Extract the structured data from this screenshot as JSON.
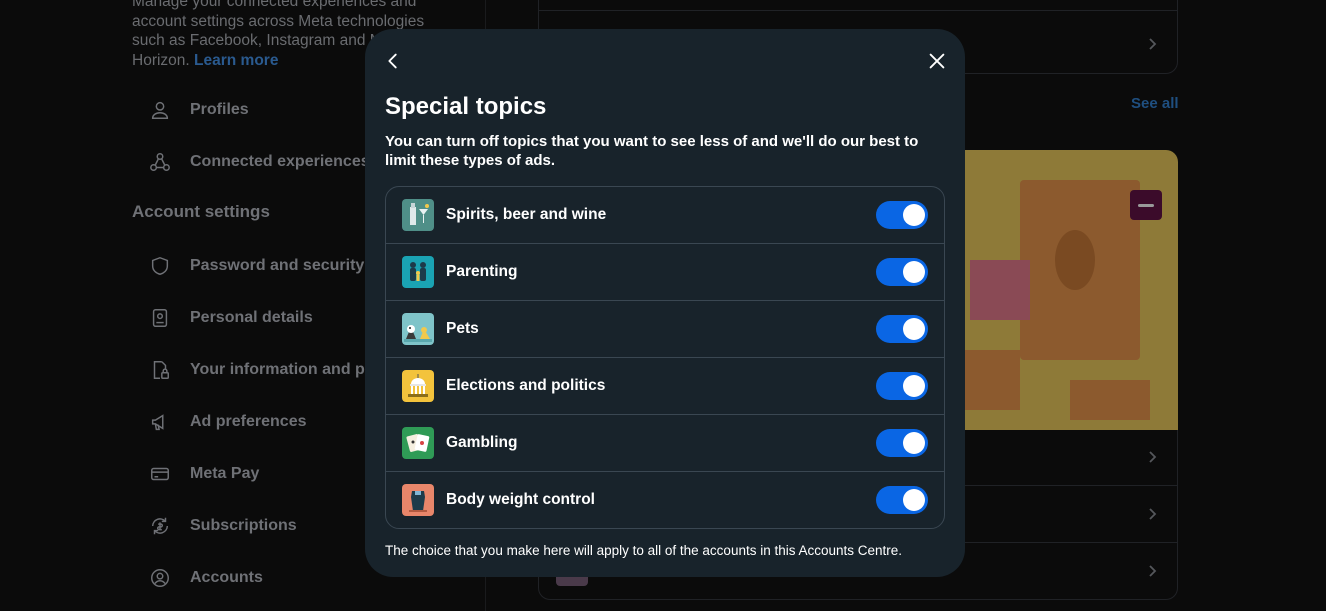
{
  "background": {
    "intro_lines": [
      "Manage your connected experiences and",
      "account settings across Meta technologies",
      "such as Facebook, Instagram and M",
      "Horizon."
    ],
    "learn_more": "Learn more",
    "nav_top": [
      {
        "label": "Profiles",
        "icon": "person-icon"
      },
      {
        "label": "Connected experiences",
        "icon": "connected-icon"
      }
    ],
    "account_settings_heading": "Account settings",
    "nav_account": [
      {
        "label": "Password and security",
        "icon": "shield-icon"
      },
      {
        "label": "Personal details",
        "icon": "id-card-icon"
      },
      {
        "label": "Your information and per",
        "icon": "doc-lock-icon"
      },
      {
        "label": "Ad preferences",
        "icon": "megaphone-icon"
      },
      {
        "label": "Meta Pay",
        "icon": "card-icon"
      },
      {
        "label": "Subscriptions",
        "icon": "subscription-icon"
      },
      {
        "label": "Accounts",
        "icon": "account-circle-icon"
      }
    ],
    "see_all": "See all"
  },
  "modal": {
    "title": "Special topics",
    "description_line1": "You can turn off topics that you want to see less of and we'll do our best to",
    "description_line2": "limit these types of ads.",
    "topics": [
      {
        "label": "Spirits, beer and wine",
        "icon": "drinks-icon",
        "on": true,
        "icon_bg": "#4f8f88"
      },
      {
        "label": "Parenting",
        "icon": "family-icon",
        "on": true,
        "icon_bg": "#1aa3b3"
      },
      {
        "label": "Pets",
        "icon": "pets-icon",
        "on": true,
        "icon_bg": "#7fc4c9"
      },
      {
        "label": "Elections and politics",
        "icon": "capitol-icon",
        "on": true,
        "icon_bg": "#f3c33c"
      },
      {
        "label": "Gambling",
        "icon": "cards-icon",
        "on": true,
        "icon_bg": "#2f9b56"
      },
      {
        "label": "Body weight control",
        "icon": "scale-icon",
        "on": true,
        "icon_bg": "#e8866a"
      }
    ],
    "footer": "The choice that you make here will apply to all of the accounts in this Accounts Centre."
  },
  "colors": {
    "modal_bg": "#18232b",
    "toggle_on": "#0a66e4",
    "border": "#3a4752"
  }
}
